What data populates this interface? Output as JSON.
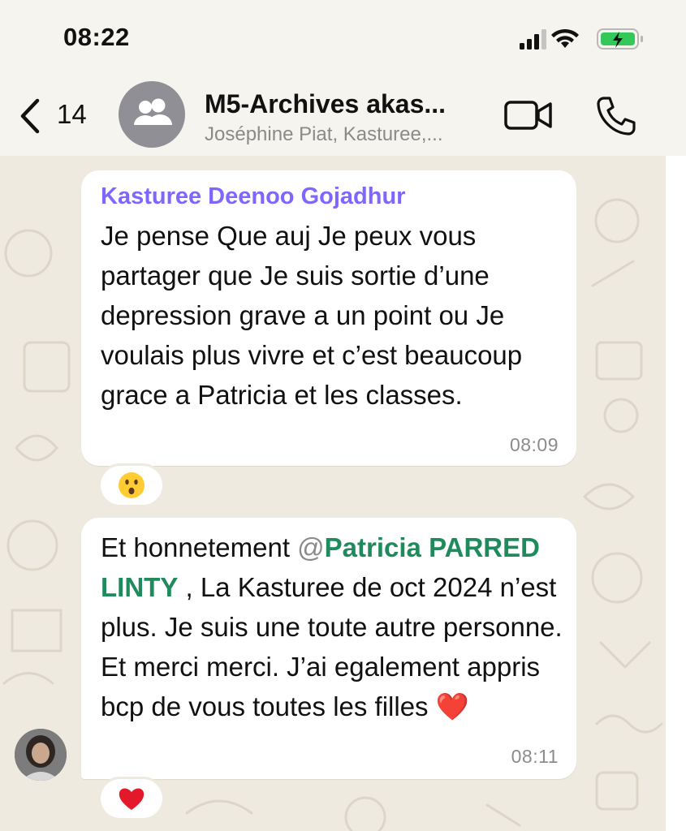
{
  "status_bar": {
    "time": "08:22"
  },
  "header": {
    "back_count": "14",
    "title": "M5-Archives akas...",
    "subtitle": "Joséphine Piat, Kasturee,..."
  },
  "messages": [
    {
      "sender": "Kasturee Deenoo Gojadhur",
      "text": "Je pense Que auj Je peux vous partager que Je suis sortie d’une depression grave a un point ou Je voulais plus vivre et c’est beaucoup grace a Patricia et les classes.",
      "time": "08:09",
      "reaction": "surprised-face"
    },
    {
      "text_before": "Et honnetement ",
      "mention_at": "@",
      "mention_name": "Patricia PARRED LINTY",
      "text_after": " , La Kasturee de oct 2024 n’est plus. Je suis une toute autre personne. Et merci merci. J’ai egalement appris bcp de vous toutes les filles ",
      "emoji": "❤️",
      "time": "08:11",
      "reaction": "heart"
    }
  ],
  "colors": {
    "sender_name": "#7f66ff",
    "mention": "#1f8a5b",
    "chat_background": "#efeae0",
    "battery": "#34c759"
  }
}
